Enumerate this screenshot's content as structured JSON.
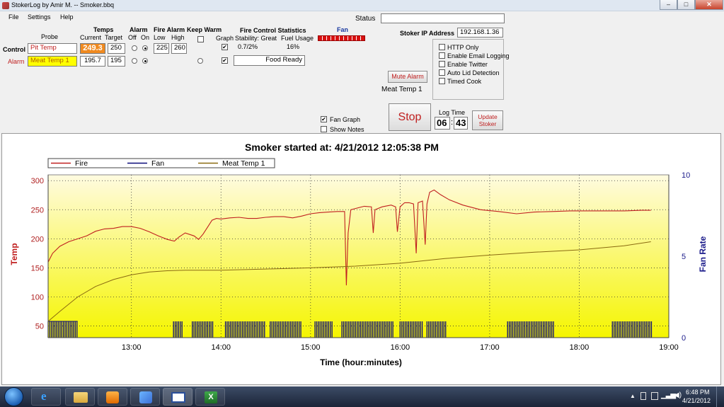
{
  "window": {
    "title": "StokerLog by Amir M. -- Smoker.bbq",
    "controls": {
      "minimize": "–",
      "maximize": "□",
      "close": "✕"
    }
  },
  "menu": [
    "File",
    "Settings",
    "Help"
  ],
  "status": {
    "label": "Status",
    "value": ""
  },
  "probes": {
    "headers": {
      "probe": "Probe",
      "temps": "Temps",
      "current": "Current",
      "target": "Target",
      "alarm": "Alarm",
      "off": "Off",
      "on": "On",
      "fire_alarm": "Fire Alarm",
      "low": "Low",
      "high": "High",
      "keep_warm": "Keep Warm",
      "graph": "Graph"
    },
    "rows": [
      {
        "role": "Control",
        "name": "Pit Temp",
        "current": "249.3",
        "target": "250",
        "alarm_on": true,
        "fire_low": "225",
        "fire_high": "260",
        "keep_warm": false,
        "graph": true
      },
      {
        "role": "Alarm",
        "name": "Meat Temp 1",
        "current": "195.7",
        "target": "195",
        "alarm_on": true,
        "keep_warm": false,
        "graph": true,
        "status": "Food Ready"
      }
    ]
  },
  "fire_control": {
    "label": "Fire Control Statistics",
    "stability_label": "Stability: Great",
    "stability_value": "0.7/2%",
    "fuel_label": "Fuel Usage",
    "fuel_value": "16%"
  },
  "fan": {
    "label": "Fan"
  },
  "stoker": {
    "ip_label": "Stoker IP Address",
    "ip_value": "192.168.1.36",
    "options": [
      {
        "label": "HTTP Only",
        "checked": false
      },
      {
        "label": "Enable Email Logging",
        "checked": false
      },
      {
        "label": "Enable Twitter",
        "checked": false
      },
      {
        "label": "Auto Lid Detection",
        "checked": false
      },
      {
        "label": "Timed Cook",
        "checked": false
      }
    ]
  },
  "mute_alarm": {
    "label": "Mute Alarm",
    "probe": "Meat Temp 1"
  },
  "graph_options": [
    {
      "label": "Fan Graph",
      "checked": true
    },
    {
      "label": "Show Notes",
      "checked": false
    }
  ],
  "stop_label": "Stop",
  "log_time": {
    "label": "Log Time",
    "hours": "06",
    "sep": ":",
    "minutes": "43"
  },
  "update_label": "Update Stoker",
  "chart_data": {
    "type": "line",
    "title": "Smoker started at: 4/21/2012 12:05:38 PM",
    "xlabel": "Time (hour:minutes)",
    "ylabel": "Temp",
    "y2label": "Fan Rate",
    "xlim": [
      12.07,
      19.0
    ],
    "x_ticks": [
      "13:00",
      "14:00",
      "15:00",
      "16:00",
      "17:00",
      "18:00",
      "19:00"
    ],
    "ylim": [
      30,
      310
    ],
    "y_ticks": [
      50,
      100,
      150,
      200,
      250,
      300
    ],
    "y2lim": [
      0,
      10
    ],
    "y2_ticks": [
      0,
      5,
      10
    ],
    "grid": true,
    "legend": [
      "Fire",
      "Fan",
      "Meat Temp 1"
    ],
    "series": [
      {
        "name": "Fire",
        "color": "#c02020",
        "points": [
          [
            12.07,
            160
          ],
          [
            12.12,
            175
          ],
          [
            12.2,
            187
          ],
          [
            12.3,
            195
          ],
          [
            12.4,
            200
          ],
          [
            12.5,
            205
          ],
          [
            12.6,
            213
          ],
          [
            12.7,
            217
          ],
          [
            12.8,
            218
          ],
          [
            12.9,
            221
          ],
          [
            13.0,
            221
          ],
          [
            13.1,
            218
          ],
          [
            13.2,
            212
          ],
          [
            13.3,
            205
          ],
          [
            13.4,
            199
          ],
          [
            13.48,
            196
          ],
          [
            13.53,
            203
          ],
          [
            13.6,
            210
          ],
          [
            13.7,
            205
          ],
          [
            13.75,
            199
          ],
          [
            13.8,
            208
          ],
          [
            13.85,
            220
          ],
          [
            13.9,
            232
          ],
          [
            13.95,
            235
          ],
          [
            14.0,
            234
          ],
          [
            14.1,
            236
          ],
          [
            14.2,
            237
          ],
          [
            14.3,
            235
          ],
          [
            14.4,
            235
          ],
          [
            14.5,
            237
          ],
          [
            14.6,
            238
          ],
          [
            14.7,
            238
          ],
          [
            14.8,
            236
          ],
          [
            14.9,
            239
          ],
          [
            15.0,
            243
          ],
          [
            15.1,
            245
          ],
          [
            15.2,
            246
          ],
          [
            15.3,
            247
          ],
          [
            15.38,
            247
          ],
          [
            15.4,
            120
          ],
          [
            15.42,
            210
          ],
          [
            15.45,
            250
          ],
          [
            15.5,
            252
          ],
          [
            15.6,
            256
          ],
          [
            15.68,
            255
          ],
          [
            15.7,
            210
          ],
          [
            15.72,
            250
          ],
          [
            15.8,
            255
          ],
          [
            15.9,
            258
          ],
          [
            15.95,
            255
          ],
          [
            15.97,
            212
          ],
          [
            16.0,
            255
          ],
          [
            16.05,
            262
          ],
          [
            16.1,
            262
          ],
          [
            16.15,
            260
          ],
          [
            16.18,
            175
          ],
          [
            16.2,
            262
          ],
          [
            16.25,
            265
          ],
          [
            16.28,
            190
          ],
          [
            16.3,
            260
          ],
          [
            16.33,
            280
          ],
          [
            16.38,
            284
          ],
          [
            16.45,
            276
          ],
          [
            16.55,
            267
          ],
          [
            16.7,
            258
          ],
          [
            16.9,
            250
          ],
          [
            17.1,
            247
          ],
          [
            17.3,
            243
          ],
          [
            17.5,
            246
          ],
          [
            17.7,
            247
          ],
          [
            17.9,
            248
          ],
          [
            18.1,
            248
          ],
          [
            18.3,
            248
          ],
          [
            18.5,
            248
          ],
          [
            18.7,
            249
          ],
          [
            18.8,
            249
          ]
        ]
      },
      {
        "name": "Meat Temp 1",
        "color": "#8a6a10",
        "points": [
          [
            12.07,
            58
          ],
          [
            12.2,
            75
          ],
          [
            12.4,
            100
          ],
          [
            12.6,
            118
          ],
          [
            12.8,
            130
          ],
          [
            13.0,
            138
          ],
          [
            13.2,
            143
          ],
          [
            13.4,
            145
          ],
          [
            13.6,
            146
          ],
          [
            14.0,
            146
          ],
          [
            14.5,
            148
          ],
          [
            15.0,
            150
          ],
          [
            15.5,
            153
          ],
          [
            16.0,
            158
          ],
          [
            16.5,
            166
          ],
          [
            17.0,
            172
          ],
          [
            17.5,
            177
          ],
          [
            18.0,
            181
          ],
          [
            18.5,
            188
          ],
          [
            18.8,
            195
          ]
        ]
      }
    ],
    "fan_bursts": [
      [
        12.07,
        12.4
      ],
      [
        13.47,
        13.58
      ],
      [
        13.68,
        13.92
      ],
      [
        14.05,
        14.5
      ],
      [
        14.55,
        14.9
      ],
      [
        15.05,
        15.25
      ],
      [
        15.35,
        15.92
      ],
      [
        16.0,
        16.25
      ],
      [
        16.3,
        16.52
      ],
      [
        17.2,
        17.72
      ],
      [
        18.37,
        18.82
      ]
    ]
  }
}
